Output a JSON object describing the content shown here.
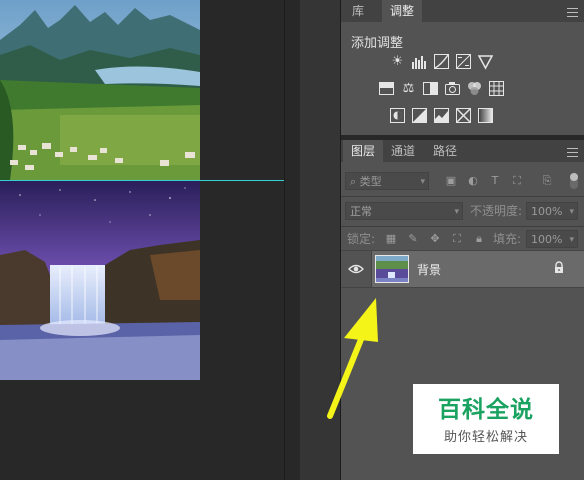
{
  "top_panel": {
    "tabs": [
      {
        "label": "库",
        "active": false
      },
      {
        "label": "调整",
        "active": true
      }
    ],
    "title": "添加调整",
    "adjustment_icons": {
      "row1": [
        "brightness-contrast-icon",
        "levels-icon",
        "curves-icon",
        "exposure-icon",
        "gradient-triangle-icon"
      ],
      "row2": [
        "vibrance-icon",
        "color-balance-icon",
        "black-white-icon",
        "photo-filter-icon",
        "channel-mixer-icon",
        "color-lookup-icon"
      ],
      "row3": [
        "invert-icon",
        "posterize-icon",
        "threshold-icon",
        "selective-color-icon",
        "gradient-map-icon"
      ]
    }
  },
  "layers_panel": {
    "tabs": [
      {
        "label": "图层",
        "active": true
      },
      {
        "label": "通道",
        "active": false
      },
      {
        "label": "路径",
        "active": false
      }
    ],
    "filter": {
      "value": "类型"
    },
    "blend_mode": {
      "value": "正常"
    },
    "opacity": {
      "label": "不透明度:",
      "value": "100%"
    },
    "lock": {
      "label": "锁定:"
    },
    "fill": {
      "label": "填充:",
      "value": "100%"
    },
    "layers": [
      {
        "name": "背景",
        "visible": true,
        "locked": true
      }
    ]
  },
  "watermark": {
    "title": "百科全说",
    "subtitle": "助你轻松解决"
  },
  "colors": {
    "guide": "#34d0d6",
    "arrow": "#f4f419",
    "watermark_green": "#1aa260"
  }
}
